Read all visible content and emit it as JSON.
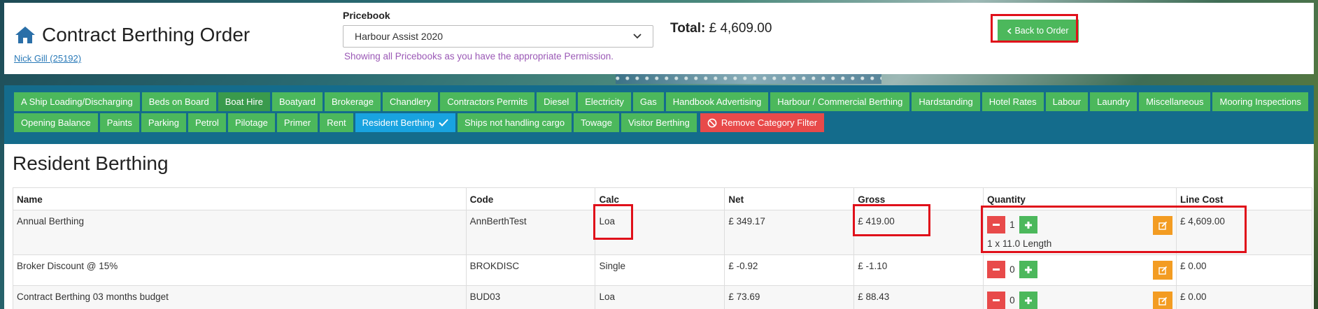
{
  "header": {
    "title": "Contract Berthing Order",
    "user_link": "Nick Gill (25192)",
    "pricebook_label": "Pricebook",
    "pricebook_selected": "Harbour Assist 2020",
    "pricebook_note": "Showing all Pricebooks as you have the appropriate Permission.",
    "total_label": "Total:",
    "total_value": "£ 4,609.00",
    "back_button": "Back to Order"
  },
  "categories": {
    "row1": [
      "A Ship Loading/Discharging",
      "Beds on Board",
      "Boat Hire",
      "Boatyard",
      "Brokerage",
      "Chandlery",
      "Contractors Permits",
      "Diesel",
      "Electricity",
      "Gas",
      "Handbook Advertising",
      "Harbour / Commercial Berthing",
      "Hardstanding",
      "Hotel Rates",
      "Labour",
      "Laundry",
      "Miscellaneous",
      "Mooring Inspections"
    ],
    "row2": [
      "Opening Balance",
      "Paints",
      "Parking",
      "Petrol",
      "Pilotage",
      "Primer",
      "Rent",
      "Resident Berthing",
      "Ships not handling cargo",
      "Towage",
      "Visitor Berthing"
    ],
    "remove_filter": "Remove Category Filter"
  },
  "section_title": "Resident Berthing",
  "table": {
    "headers": [
      "Name",
      "Code",
      "Calc",
      "Net",
      "Gross",
      "Quantity",
      "",
      "Line Cost"
    ],
    "rows": [
      {
        "name": "Annual Berthing",
        "code": "AnnBerthTest",
        "calc": "Loa",
        "net": "£ 349.17",
        "gross": "£ 419.00",
        "qty": "1",
        "qty_note": "1 x 11.0 Length",
        "line_cost": "£ 4,609.00"
      },
      {
        "name": "Broker Discount @ 15%",
        "code": "BROKDISC",
        "calc": "Single",
        "net": "£ -0.92",
        "gross": "£ -1.10",
        "qty": "0",
        "qty_note": "",
        "line_cost": "£ 0.00"
      },
      {
        "name": "Contract Berthing 03 months budget",
        "code": "BUD03",
        "calc": "Loa",
        "net": "£ 73.69",
        "gross": "£ 88.43",
        "qty": "0",
        "qty_note": "",
        "line_cost": "£ 0.00"
      }
    ]
  },
  "colors": {
    "accent_green": "#4cb85c",
    "active_blue": "#19a3e0",
    "danger_red": "#e84a4a",
    "edit_orange": "#f39c22",
    "category_bar": "#146c8c",
    "highlight": "#e0101a"
  }
}
